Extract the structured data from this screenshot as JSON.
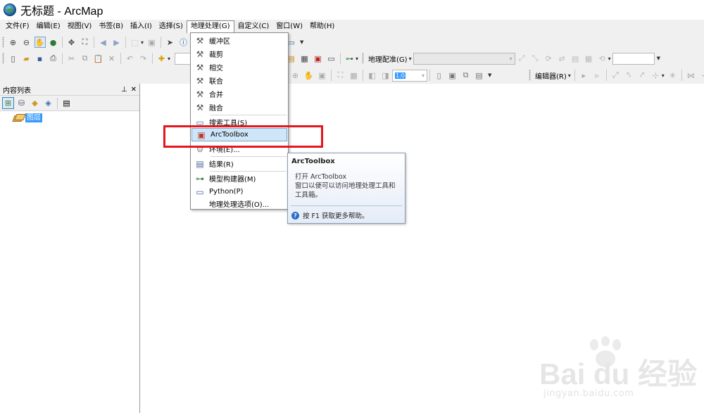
{
  "window": {
    "title": "无标题 - ArcMap"
  },
  "menubar": {
    "items": [
      "文件(F)",
      "编辑(E)",
      "视图(V)",
      "书签(B)",
      "插入(I)",
      "选择(S)",
      "地理处理(G)",
      "自定义(C)",
      "窗口(W)",
      "帮助(H)"
    ],
    "active_index": 6
  },
  "toolbars": {
    "georef_label": "地理配准(G)",
    "editor_label": "编辑器(R)",
    "scale_value": "1:0"
  },
  "toc": {
    "title": "内容列表",
    "pin": "ᵖ",
    "close": "✕",
    "layer_name": "图层"
  },
  "geoprocessing_menu": {
    "items": [
      {
        "label": "缓冲区",
        "icon": "hammer-icon"
      },
      {
        "label": "裁剪",
        "icon": "hammer-icon"
      },
      {
        "label": "相交",
        "icon": "hammer-icon"
      },
      {
        "label": "联合",
        "icon": "hammer-icon"
      },
      {
        "label": "合并",
        "icon": "hammer-icon"
      },
      {
        "label": "融合",
        "icon": "hammer-icon"
      },
      {
        "label": "搜索工具(S)",
        "icon": "search-window-icon"
      },
      {
        "label": "ArcToolbox",
        "icon": "toolbox-icon"
      },
      {
        "label": "环境(E)...",
        "icon": "environment-icon"
      },
      {
        "label": "结果(R)",
        "icon": "results-icon"
      },
      {
        "label": "模型构建器(M)",
        "icon": "model-builder-icon"
      },
      {
        "label": "Python(P)",
        "icon": "python-window-icon"
      },
      {
        "label": "地理处理选项(O)...",
        "icon": ""
      }
    ],
    "highlight_index": 7
  },
  "tooltip": {
    "title": "ArcToolbox",
    "description": "打开 ArcToolbox\n窗口以便可以访问地理处理工具和\n工具箱。",
    "help_text": "按 F1 获取更多帮助。"
  },
  "watermark": {
    "brand": "Bai du 经验",
    "url": "jingyan.baidu.com"
  },
  "colors": {
    "highlight_box": "#e5161d",
    "layer_selected": "#3399ff",
    "menu_highlight": "#cfe5f8"
  }
}
